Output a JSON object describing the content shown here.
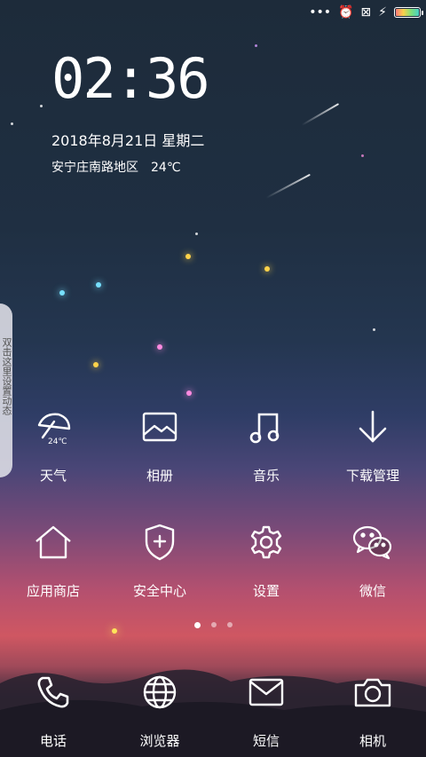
{
  "status_bar": {
    "icons": [
      "more-dots-icon",
      "alarm-icon",
      "no-sim-icon",
      "charging-icon",
      "battery-icon"
    ]
  },
  "lock": {
    "time": "02:36",
    "date": "2018年8月21日 星期二",
    "location": "安宁庄南路地区",
    "temperature": "24℃"
  },
  "side_tab": {
    "text": "双击这里设置动态"
  },
  "apps_row1": [
    {
      "label": "天气",
      "icon": "umbrella-icon",
      "badge": "24℃"
    },
    {
      "label": "相册",
      "icon": "image-icon"
    },
    {
      "label": "音乐",
      "icon": "music-note-icon"
    },
    {
      "label": "下载管理",
      "icon": "download-arrow-icon"
    }
  ],
  "apps_row2": [
    {
      "label": "应用商店",
      "icon": "home-icon"
    },
    {
      "label": "安全中心",
      "icon": "shield-plus-icon"
    },
    {
      "label": "设置",
      "icon": "gear-icon"
    },
    {
      "label": "微信",
      "icon": "wechat-icon"
    }
  ],
  "pager": {
    "count": 3,
    "active": 1
  },
  "dock": [
    {
      "label": "电话",
      "icon": "phone-icon"
    },
    {
      "label": "浏览器",
      "icon": "globe-icon"
    },
    {
      "label": "短信",
      "icon": "envelope-icon"
    },
    {
      "label": "相机",
      "icon": "camera-icon"
    }
  ]
}
